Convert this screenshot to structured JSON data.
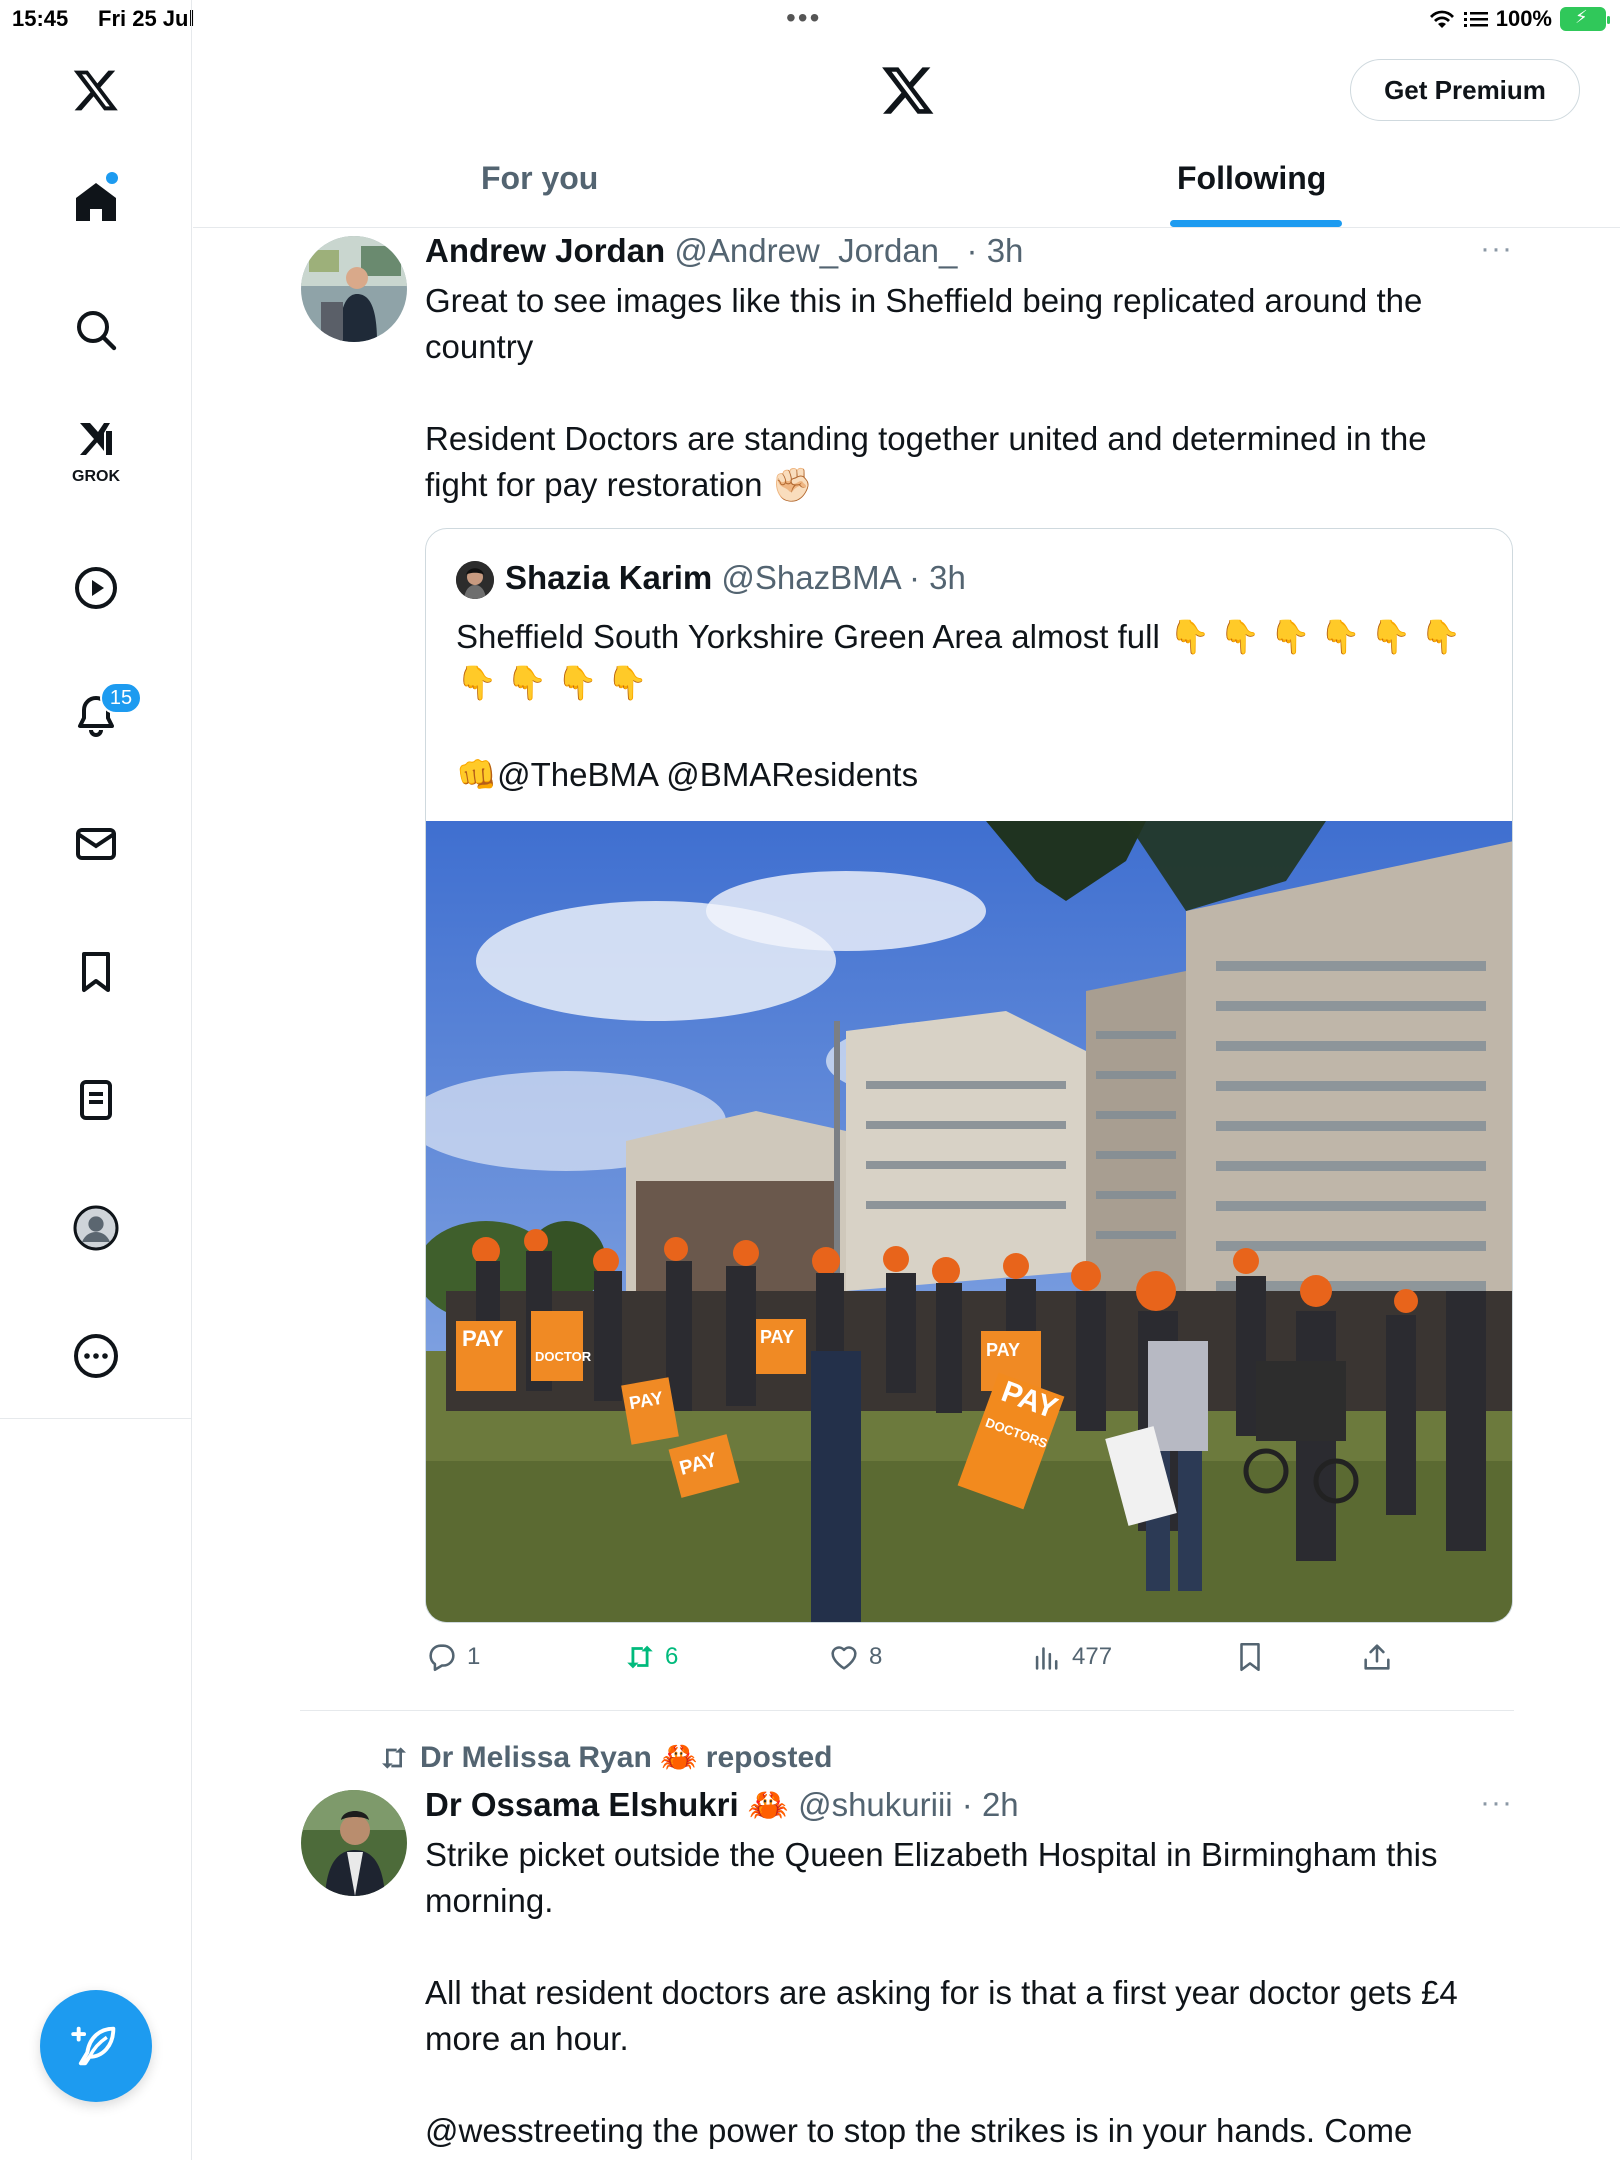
{
  "status_bar": {
    "time": "15:45",
    "date": "Fri 25 Jul",
    "battery": "100%"
  },
  "rail": {
    "grok_label": "GROK",
    "notifications_count": "15"
  },
  "header": {
    "premium_label": "Get Premium",
    "tabs": [
      {
        "label": "For you",
        "active": false
      },
      {
        "label": "Following",
        "active": true
      }
    ]
  },
  "tweet1": {
    "name": "Andrew Jordan",
    "handle": "@Andrew_Jordan_",
    "time": "3h",
    "text": "Great to see images like this in Sheffield being replicated around the\ncountry\n\nResident Doctors are standing together united and determined in the\nfight for pay restoration ✊🏻",
    "quote": {
      "name": "Shazia Karim",
      "handle": "@ShazBMA",
      "time": "3h",
      "text": "Sheffield South Yorkshire Green Area almost full 👇 👇 👇 👇 👇 👇\n👇 👇 👇 👇\n\n👊@TheBMA @BMAResidents",
      "photo_signs": [
        "PAY",
        "PAY",
        "PAY",
        "PAY",
        "PAY",
        "PAY",
        "DOCTORS",
        "DOCTOR"
      ]
    },
    "stats": {
      "replies": "1",
      "reposts": "6",
      "likes": "8",
      "views": "477"
    }
  },
  "tweet2": {
    "reposted_by": "Dr Melissa Ryan 🦀 reposted",
    "name": "Dr Ossama Elshukri 🦀",
    "handle": "@shukuriii",
    "time": "2h",
    "text": "Strike picket outside the Queen Elizabeth Hospital in Birmingham this\nmorning.\n\nAll that resident doctors are asking for is that a first year doctor gets £4\nmore an hour.\n\n@wesstreeting the power to stop the strikes is in your hands. Come"
  },
  "colors": {
    "accent": "#1d9bf0",
    "repost_green": "#00ba7c",
    "secondary_text": "#536471"
  }
}
